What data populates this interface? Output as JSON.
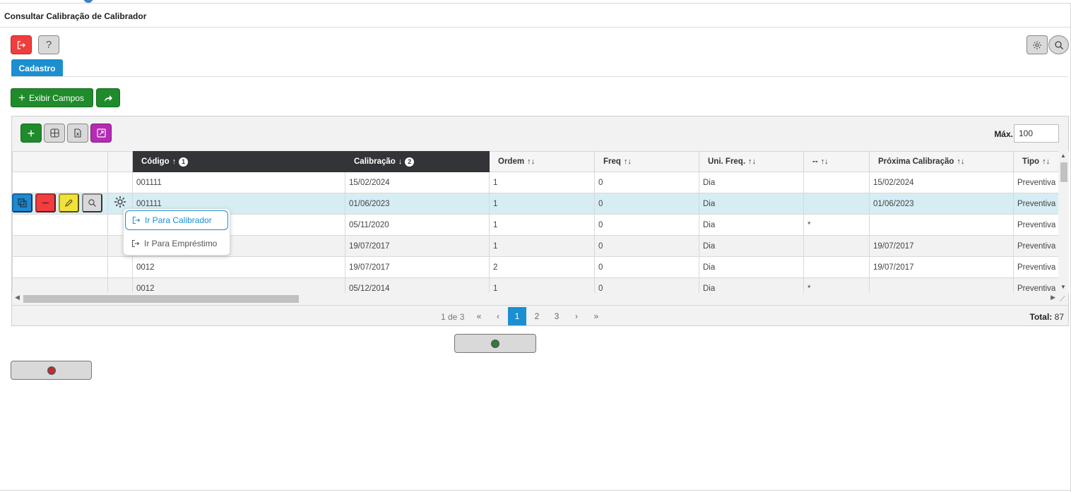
{
  "page": {
    "title": "Consultar Calibração de Calibrador"
  },
  "tabs": {
    "cadastro": "Cadastro"
  },
  "toolbar": {
    "exibir_campos": "Exibir Campos",
    "max_label": "Máx.",
    "max_value": "100"
  },
  "icons": {
    "exit": "exit-icon",
    "help": "question-icon",
    "settings": "gear-icon",
    "search": "search-icon",
    "add": "plus-icon",
    "grid": "grid-icon",
    "excel": "excel-icon",
    "expand": "expand-icon",
    "share": "share-arrow-icon",
    "duplicate": "copy-icon",
    "delete": "minus-icon",
    "edit": "pencil-icon",
    "view": "magnifier-icon",
    "row_menu": "gear-icon",
    "power": "power-icon"
  },
  "colors": {
    "accent": "#1b8fd0",
    "green": "#1f8b2b",
    "red": "#f03e3e",
    "yellow": "#f2e23c",
    "purple": "#b52bb4",
    "header_dark": "#323437"
  },
  "table": {
    "columns": [
      {
        "label": "Código",
        "sort": "↑",
        "order": "1"
      },
      {
        "label": "Calibração",
        "sort": "↓",
        "order": "2"
      },
      {
        "label": "Ordem",
        "sort": "↑↓"
      },
      {
        "label": "Freq",
        "sort": "↑↓"
      },
      {
        "label": "Uni. Freq.",
        "sort": "↑↓"
      },
      {
        "label": "--",
        "sort": "↑↓"
      },
      {
        "label": "Próxima Calibração",
        "sort": "↑↓"
      },
      {
        "label": "Tipo",
        "sort": "↑↓"
      }
    ],
    "rows": [
      {
        "codigo": "001111",
        "calibracao": "15/02/2024",
        "ordem": "1",
        "freq": "0",
        "uni": "Dia",
        "extra": "",
        "proxima": "15/02/2024",
        "tipo": "Preventiva"
      },
      {
        "codigo": "001111",
        "calibracao": "01/06/2023",
        "ordem": "1",
        "freq": "0",
        "uni": "Dia",
        "extra": "",
        "proxima": "01/06/2023",
        "tipo": "Preventiva"
      },
      {
        "codigo": "",
        "calibracao": "05/11/2020",
        "ordem": "1",
        "freq": "0",
        "uni": "Dia",
        "extra": "*",
        "proxima": "",
        "tipo": "Preventiva"
      },
      {
        "codigo": "",
        "calibracao": "19/07/2017",
        "ordem": "1",
        "freq": "0",
        "uni": "Dia",
        "extra": "",
        "proxima": "19/07/2017",
        "tipo": "Preventiva"
      },
      {
        "codigo": "0012",
        "calibracao": "19/07/2017",
        "ordem": "2",
        "freq": "0",
        "uni": "Dia",
        "extra": "",
        "proxima": "19/07/2017",
        "tipo": "Preventiva"
      },
      {
        "codigo": "0012",
        "calibracao": "05/12/2014",
        "ordem": "1",
        "freq": "0",
        "uni": "Dia",
        "extra": "*",
        "proxima": "",
        "tipo": "Preventiva"
      }
    ]
  },
  "context_menu": {
    "items": [
      "Ir Para Calibrador",
      "Ir Para Empréstimo"
    ]
  },
  "pagination": {
    "info": "1 de 3",
    "first": "«",
    "prev": "‹",
    "pages": [
      "1",
      "2",
      "3"
    ],
    "next": "›",
    "last": "»",
    "total_label": "Total:",
    "total_value": "87"
  }
}
